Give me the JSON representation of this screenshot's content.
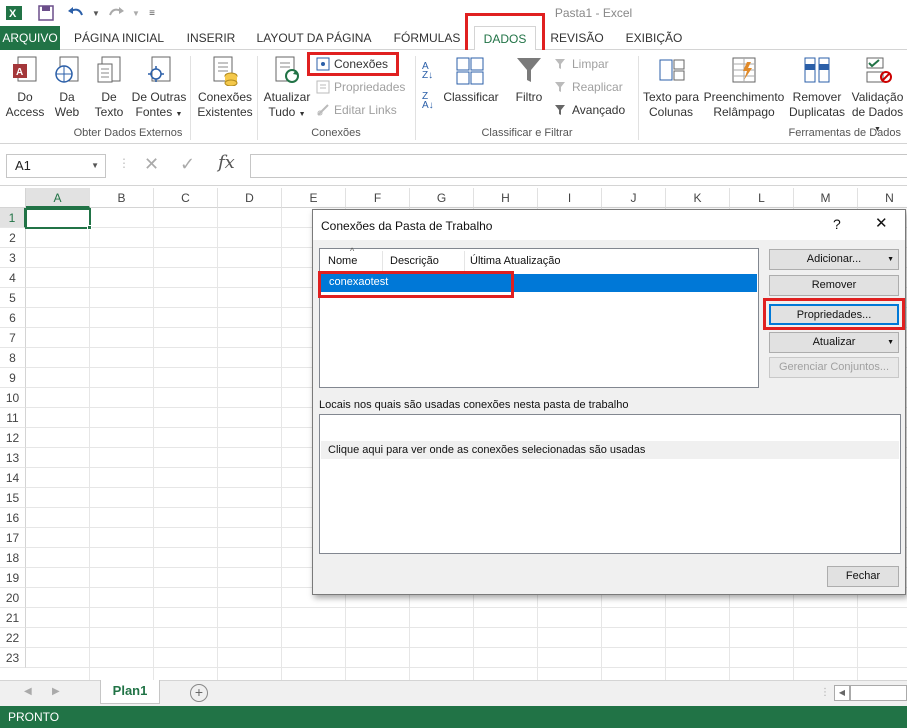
{
  "window": {
    "title": "Pasta1 - Excel"
  },
  "quick_access": {
    "excel_icon": "excel-logo-icon",
    "save_icon": "save-icon",
    "undo_icon": "undo-icon",
    "redo_icon": "redo-icon",
    "customize_icon": "customize-icon"
  },
  "tabs": [
    {
      "label": "ARQUIVO",
      "active": false
    },
    {
      "label": "PÁGINA INICIAL",
      "active": false
    },
    {
      "label": "INSERIR",
      "active": false
    },
    {
      "label": "LAYOUT DA PÁGINA",
      "active": false
    },
    {
      "label": "FÓRMULAS",
      "active": false
    },
    {
      "label": "DADOS",
      "active": true
    },
    {
      "label": "REVISÃO",
      "active": false
    },
    {
      "label": "EXIBIÇÃO",
      "active": false
    }
  ],
  "ribbon": {
    "external": {
      "access": {
        "l1": "Do",
        "l2": "Access"
      },
      "web": {
        "l1": "Da",
        "l2": "Web"
      },
      "text": {
        "l1": "De",
        "l2": "Texto"
      },
      "other": {
        "l1": "De Outras",
        "l2": "Fontes"
      },
      "existing": {
        "l1": "Conexões",
        "l2": "Existentes"
      },
      "group": "Obter Dados Externos"
    },
    "connections": {
      "refresh": {
        "l1": "Atualizar",
        "l2": "Tudo"
      },
      "conexoes": "Conexões",
      "propriedades": "Propriedades",
      "editar_links": "Editar Links",
      "group": "Conexões"
    },
    "sort": {
      "classificar": "Classificar",
      "filtro": "Filtro",
      "limpar": "Limpar",
      "reaplicar": "Reaplicar",
      "avancado": "Avançado",
      "group": "Classificar e Filtrar"
    },
    "tools": {
      "texto_colunas": {
        "l1": "Texto para",
        "l2": "Colunas"
      },
      "preenchimento": {
        "l1": "Preenchimento",
        "l2": "Relâmpago"
      },
      "remover_dup": {
        "l1": "Remover",
        "l2": "Duplicatas"
      },
      "validacao": {
        "l1": "Validação",
        "l2": "de Dados"
      },
      "group": "Ferramentas de Dados"
    }
  },
  "formula_bar": {
    "name_box": "A1",
    "formula": ""
  },
  "grid": {
    "columns": [
      "A",
      "B",
      "C",
      "D",
      "E",
      "F",
      "G",
      "H",
      "I",
      "J",
      "K",
      "L",
      "M",
      "N"
    ],
    "rows": [
      "1",
      "2",
      "3",
      "4",
      "5",
      "6",
      "7",
      "8",
      "9",
      "10",
      "11",
      "12",
      "13",
      "14",
      "15",
      "16",
      "17",
      "18",
      "19",
      "20",
      "21",
      "22",
      "23"
    ],
    "active_cell": "A1"
  },
  "sheets": {
    "active": "Plan1"
  },
  "status": {
    "text": "PRONTO"
  },
  "dialog": {
    "title": "Conexões da Pasta de Trabalho",
    "help": "?",
    "close": "✕",
    "columns": {
      "nome": "Nome",
      "descricao": "Descrição",
      "ultima": "Última Atualização"
    },
    "connections": [
      {
        "name": "conexaotest",
        "selected": true
      }
    ],
    "buttons": {
      "adicionar": "Adicionar...",
      "remover": "Remover",
      "propriedades": "Propriedades...",
      "atualizar": "Atualizar",
      "gerenciar": "Gerenciar Conjuntos...",
      "fechar": "Fechar"
    },
    "locais_label": "Locais nos quais são usadas conexões nesta pasta de trabalho",
    "locais_hint": "Clique aqui para ver onde as conexões selecionadas são usadas"
  },
  "colors": {
    "excel_green": "#217346",
    "selection_blue": "#0078d7",
    "highlight_red": "#e02020"
  }
}
